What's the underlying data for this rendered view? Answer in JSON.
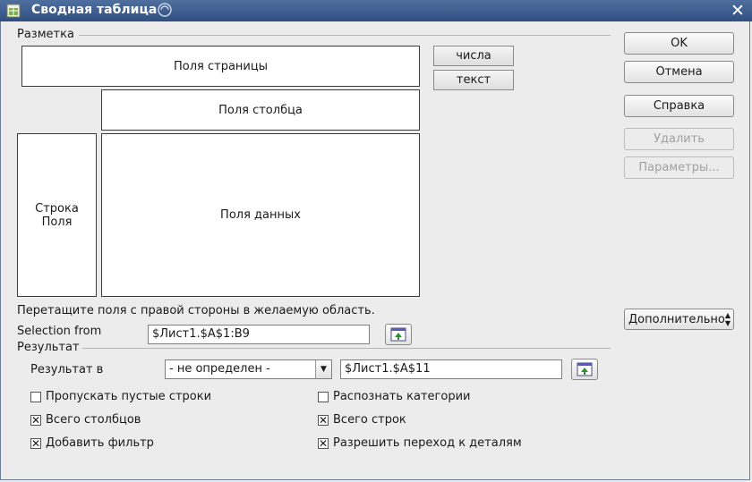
{
  "window": {
    "title": "Сводная таблица",
    "close_glyph": "✕"
  },
  "layout_group": {
    "label": "Разметка",
    "page_fields": "Поля страницы",
    "column_fields": "Поля столбца",
    "row_fields_line1": "Строка",
    "row_fields_line2": "Поля",
    "data_fields": "Поля данных",
    "field_buttons": [
      "числа",
      "текст"
    ],
    "hint": "Перетащите поля с правой стороны в желаемую область."
  },
  "selection": {
    "label": "Selection from",
    "value": "$Лист1.$A$1:B9"
  },
  "result_group": {
    "label": "Результат",
    "result_in_label": "Результат в",
    "destination_select": "- не определен -",
    "destination_value": "$Лист1.$A$11",
    "options": [
      {
        "label": "Пропускать пустые строки",
        "checked": false
      },
      {
        "label": "Распознать категории",
        "checked": false
      },
      {
        "label": "Всего столбцов",
        "checked": true
      },
      {
        "label": "Всего строк",
        "checked": true
      },
      {
        "label": "Добавить фильтр",
        "checked": true
      },
      {
        "label": "Разрешить переход к деталям",
        "checked": true
      }
    ]
  },
  "buttons": {
    "ok": "OK",
    "cancel": "Отмена",
    "help": "Справка",
    "delete": "Удалить",
    "options": "Параметры...",
    "more": "Дополнительно"
  },
  "check_glyph": "✕"
}
